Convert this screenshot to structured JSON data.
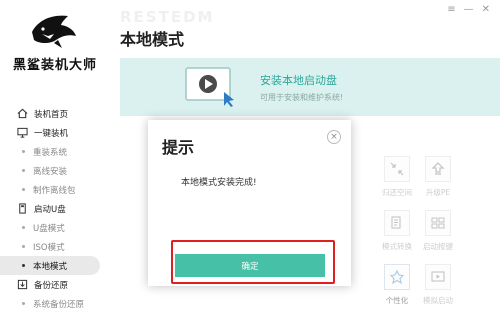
{
  "app": {
    "brand": "黑鲨装机大师",
    "bg_word": "RESTEDM",
    "page_title": "本地模式"
  },
  "window": {
    "menu_glyph": "≡",
    "minimize_glyph": "—",
    "close_glyph": "✕"
  },
  "sidebar": {
    "items": [
      {
        "label": "装机首页",
        "icon": "home-icon",
        "type": "main"
      },
      {
        "label": "一键装机",
        "icon": "monitor-icon",
        "type": "main"
      },
      {
        "label": "重装系统",
        "type": "sub"
      },
      {
        "label": "离线安装",
        "type": "sub"
      },
      {
        "label": "制作离线包",
        "type": "sub"
      },
      {
        "label": "启动U盘",
        "icon": "usb-icon",
        "type": "main"
      },
      {
        "label": "U盘模式",
        "type": "sub"
      },
      {
        "label": "ISO模式",
        "type": "sub"
      },
      {
        "label": "本地模式",
        "type": "sub",
        "active": true
      },
      {
        "label": "备份还原",
        "icon": "backup-icon",
        "type": "main"
      },
      {
        "label": "系统备份还原",
        "type": "sub"
      }
    ]
  },
  "banner": {
    "title": "安装本地启动盘",
    "subtitle": "可用于安装和维护系统!"
  },
  "tools": [
    {
      "label": "归还空间",
      "icon": "shrink-icon"
    },
    {
      "label": "升级PE",
      "icon": "upgrade-icon"
    },
    {
      "label": "模式转换",
      "icon": "convert-icon"
    },
    {
      "label": "启动按键",
      "icon": "keys-icon"
    },
    {
      "label": "个性化",
      "icon": "personalize-icon",
      "active": true
    },
    {
      "label": "模拟启动",
      "icon": "simulate-icon"
    }
  ],
  "dialog": {
    "title": "提示",
    "close_glyph": "×",
    "message": "本地模式安装完成!",
    "ok_label": "确定"
  },
  "colors": {
    "accent": "#46c0a6",
    "banner_bg": "#daf1ef",
    "banner_text": "#2ba89a",
    "highlight_box": "#e02020"
  }
}
